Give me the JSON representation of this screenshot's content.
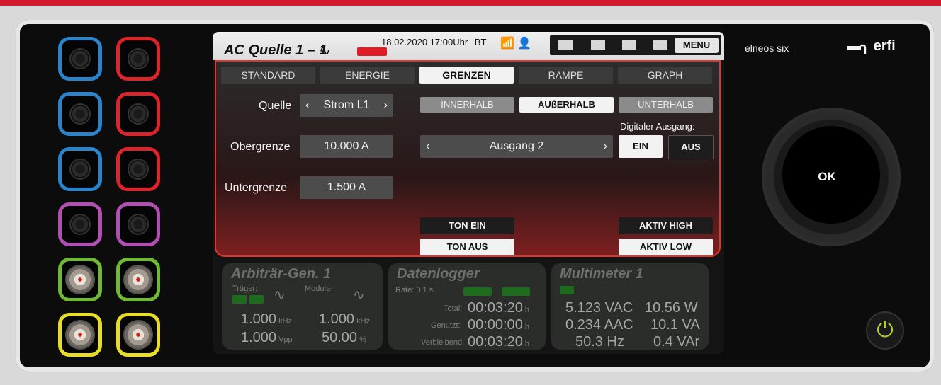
{
  "header": {
    "title": "AC Quelle 1 – 1",
    "wave_symbol": "∿",
    "datetime": "18.02.2020 17:00Uhr",
    "bt": "BT",
    "menu": "MENU"
  },
  "tabs": [
    "STANDARD",
    "ENERGIE",
    "GRENZEN",
    "RAMPE",
    "GRAPH"
  ],
  "left_form": {
    "source_label": "Quelle",
    "source_value": "Strom L1",
    "upper_label": "Obergrenze",
    "upper_value": "10.000 A",
    "lower_label": "Untergrenze",
    "lower_value": "1.500 A"
  },
  "right_form": {
    "segments": [
      "INNERHALB",
      "AUßERHALB",
      "UNTERHALB"
    ],
    "digital_label": "Digitaler Ausgang:",
    "output_value": "Ausgang 2",
    "ein": "EIN",
    "aus": "AUS",
    "ton_ein": "TON EIN",
    "ton_aus": "TON AUS",
    "aktiv_high": "AKTIV HIGH",
    "aktiv_low": "AKTIV LOW"
  },
  "widgets": {
    "arb": {
      "title": "Arbiträr-Gen. 1",
      "traeger": "Träger:",
      "modula": "Modula-",
      "freq1": "1.000",
      "freq1_unit": "kHz",
      "freq2": "1.000",
      "freq2_unit": "kHz",
      "volt": "1.000",
      "volt_unit": "Vpp",
      "pct": "50.00",
      "pct_unit": "%"
    },
    "logger": {
      "title": "Datenlogger",
      "rate": "Rate: 0.1 s",
      "total_label": "Total:",
      "total": "00:03:20",
      "used_label": "Genutzt:",
      "used": "00:00:00",
      "remain_label": "Verbleibend:",
      "remain": "00:03:20",
      "h": "h"
    },
    "multi": {
      "title": "Multimeter 1",
      "v_ac": "5.123 VAC",
      "w": "10.56 W",
      "a_ac": "0.234 AAC",
      "va": "10.1 VA",
      "hz": "50.3 Hz",
      "var": "0.4 VAr"
    }
  },
  "device": {
    "model": "elneos six",
    "brand": "erfi",
    "ok": "OK"
  }
}
